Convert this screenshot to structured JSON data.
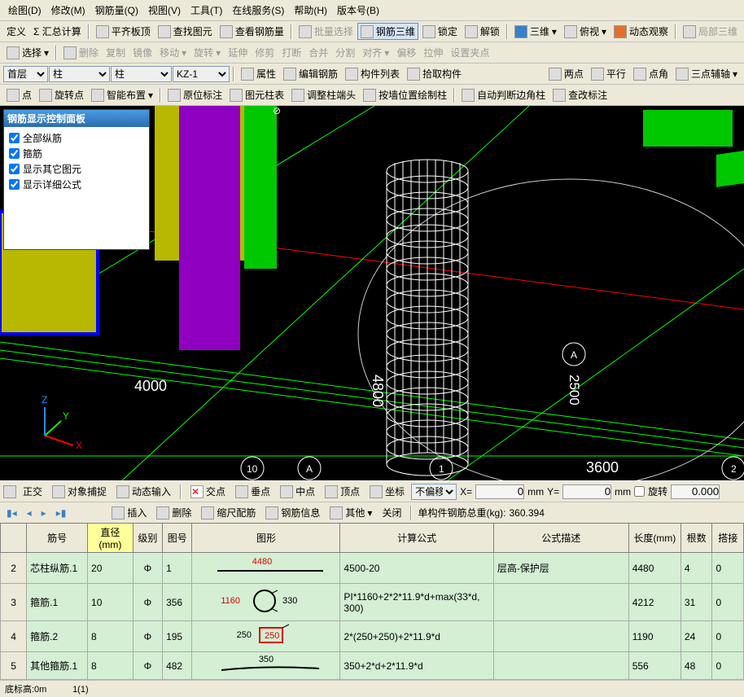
{
  "menu": [
    "绘图(D)",
    "修改(M)",
    "钢筋量(Q)",
    "视图(V)",
    "工具(T)",
    "在线服务(S)",
    "帮助(H)",
    "版本号(B)"
  ],
  "tb1": {
    "define": "定义",
    "sum": "Σ 汇总计算",
    "flat": "平齐板顶",
    "find": "查找图元",
    "viewbar": "查看钢筋量",
    "batch": "批量选择",
    "tri": "钢筋三维",
    "lock": "锁定",
    "unlock": "解锁",
    "threed": "三维",
    "perspective": "俯视",
    "dyn": "动态观察",
    "partial": "局部三维"
  },
  "tb2": {
    "select": "选择",
    "del": "删除",
    "copy": "复制",
    "mirror": "镜像",
    "move": "移动",
    "rotate": "旋转",
    "extend": "延伸",
    "trim": "修剪",
    "break": "打断",
    "merge": "合并",
    "split": "分割",
    "align": "对齐",
    "offset": "偏移",
    "stretch": "拉伸",
    "anchor": "设置夹点"
  },
  "tb3": {
    "floor": "首层",
    "cat1": "柱",
    "cat2": "柱",
    "item": "KZ-1",
    "attr": "属性",
    "editbar": "编辑钢筋",
    "memberlist": "构件列表",
    "pick": "拾取构件",
    "two": "两点",
    "parallel": "平行",
    "angle": "点角",
    "three": "三点辅轴"
  },
  "tb4": {
    "point": "点",
    "rotpt": "旋转点",
    "smart": "智能布置",
    "ip": "原位标注",
    "legend": "图元柱表",
    "adjcol": "调整柱端头",
    "drawbypos": "按墙位置绘制柱",
    "autotrim": "自动判断边角柱",
    "chkdim": "查改标注"
  },
  "panel": {
    "title": "钢筋显示控制面板",
    "items": [
      "全部纵筋",
      "箍筋",
      "显示其它图元",
      "显示详细公式"
    ]
  },
  "dims": {
    "d4000": "4000",
    "d4800": "4800",
    "d2500": "2500",
    "d3600": "3600"
  },
  "marks": {
    "a10": "10",
    "aA": "A",
    "a1": "1",
    "a2": "2"
  },
  "status": {
    "regular": "正交",
    "snap": "对象捕捉",
    "dynin": "动态输入",
    "cross": "交点",
    "perp": "垂点",
    "mid": "中点",
    "top": "顶点",
    "coord": "坐标",
    "noshift": "不偏移",
    "x": "X=",
    "y": "Y=",
    "xval": "0",
    "yval": "0",
    "mm": "mm",
    "rot": "旋转",
    "rotval": "0.000"
  },
  "nav": {
    "insert": "插入",
    "delete": "删除",
    "scale": "缩尺配筋",
    "info": "钢筋信息",
    "other": "其他",
    "close": "关闭",
    "total_label": "单构件钢筋总重(kg):",
    "total": "360.394"
  },
  "cols": [
    "",
    "筋号",
    "直径(mm)",
    "级别",
    "图号",
    "图形",
    "计算公式",
    "公式描述",
    "长度(mm)",
    "根数",
    "搭接"
  ],
  "rows": [
    {
      "n": "2",
      "id": "芯柱纵筋.1",
      "dia": "20",
      "lvl": "Φ",
      "fig": "1",
      "shape_a": "4480",
      "shape_b": "",
      "calc": "4500-20",
      "desc": "层高-保护层",
      "len": "4480",
      "cnt": "4",
      "lap": "0"
    },
    {
      "n": "3",
      "id": "箍筋.1",
      "dia": "10",
      "lvl": "Φ",
      "fig": "356",
      "shape_a": "1160",
      "shape_b": "330",
      "calc": "PI*1160+2*2*11.9*d+max(33*d, 300)",
      "desc": "",
      "len": "4212",
      "cnt": "31",
      "lap": "0"
    },
    {
      "n": "4",
      "id": "箍筋.2",
      "dia": "8",
      "lvl": "Φ",
      "fig": "195",
      "shape_a": "250",
      "shape_b": "250",
      "calc": "2*(250+250)+2*11.9*d",
      "desc": "",
      "len": "1190",
      "cnt": "24",
      "lap": "0"
    },
    {
      "n": "5",
      "id": "其他箍筋.1",
      "dia": "8",
      "lvl": "Φ",
      "fig": "482",
      "shape_a": "350",
      "shape_b": "",
      "calc": "350+2*d+2*11.9*d",
      "desc": "",
      "len": "556",
      "cnt": "48",
      "lap": "0"
    }
  ],
  "footer": {
    "base": "底标高:0m",
    "count": "1(1)"
  }
}
